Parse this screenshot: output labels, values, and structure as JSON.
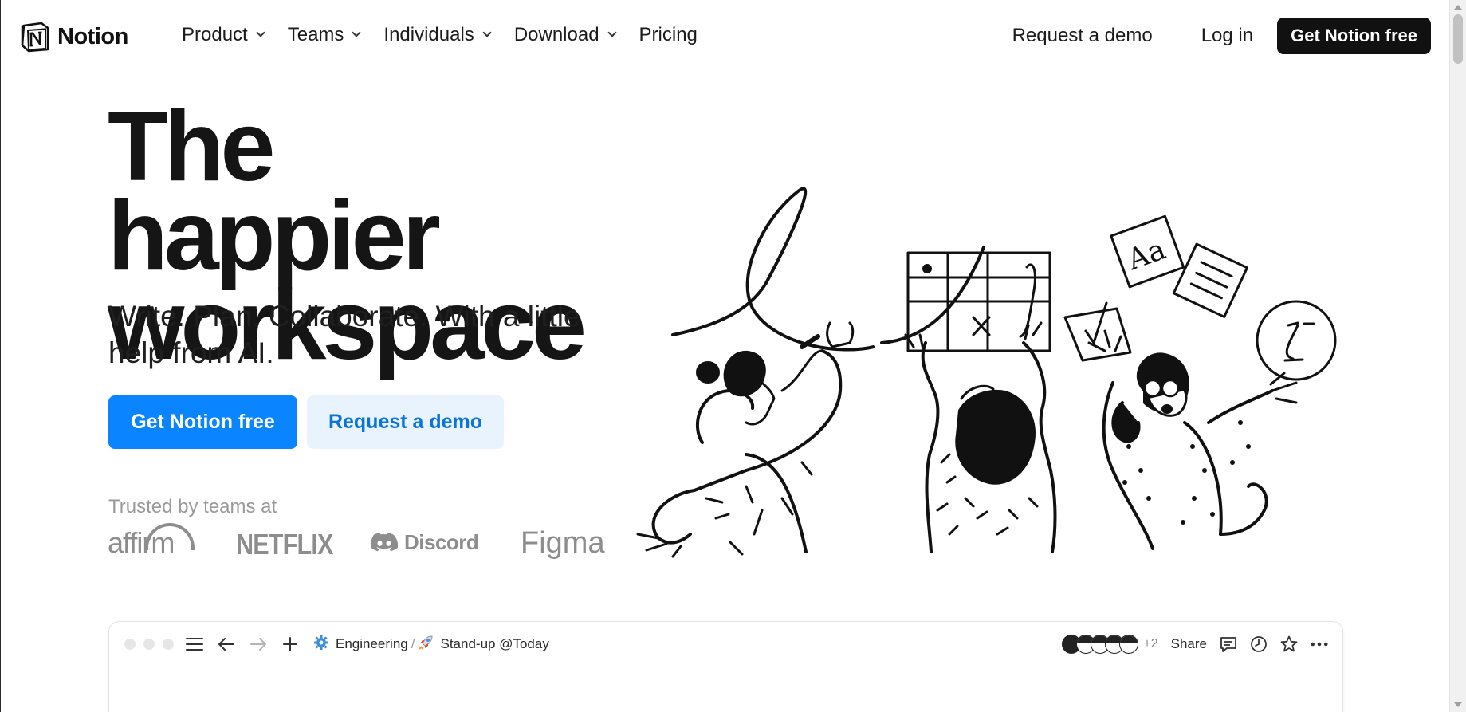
{
  "nav": {
    "brand": "Notion",
    "links": [
      {
        "label": "Product",
        "has_dropdown": true
      },
      {
        "label": "Teams",
        "has_dropdown": true
      },
      {
        "label": "Individuals",
        "has_dropdown": true
      },
      {
        "label": "Download",
        "has_dropdown": true
      },
      {
        "label": "Pricing",
        "has_dropdown": false
      }
    ],
    "request_demo": "Request a demo",
    "login": "Log in",
    "cta": "Get Notion free"
  },
  "hero": {
    "title_line1": "The happier",
    "title_line2": "workspace",
    "subtitle": "Write. Plan. Collaborate. With a little help from AI.",
    "primary_button": "Get Notion free",
    "secondary_button": "Request a demo",
    "trusted_label": "Trusted by teams at",
    "customer_logos": [
      "affirm",
      "NETFLIX",
      "Discord",
      "Figma"
    ]
  },
  "app_preview": {
    "breadcrumb": {
      "workspace_icon": "gear-icon",
      "workspace": "Engineering",
      "separator": "/",
      "page_icon": "rocket-icon",
      "page": "Stand-up @Today"
    },
    "extra_collaborators": "+2",
    "share_label": "Share"
  },
  "colors": {
    "primary_blue": "#0a85ff",
    "secondary_bg": "#e9f3fd",
    "secondary_text": "#0a74dc",
    "dark_button": "#111111",
    "logo_gray": "#8d8d8d"
  }
}
